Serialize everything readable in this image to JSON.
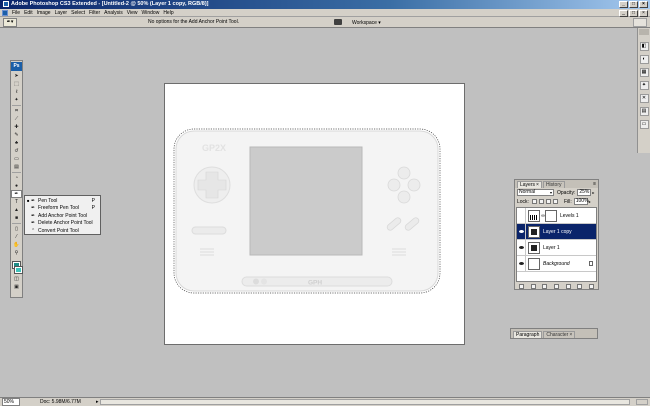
{
  "app": {
    "title": "Adobe Photoshop CS3 Extended - [Untitled-2 @ 50% (Layer 1 copy, RGB/8)]",
    "window_controls": [
      "_",
      "□",
      "×"
    ]
  },
  "menubar": {
    "items": [
      "File",
      "Edit",
      "Image",
      "Layer",
      "Select",
      "Filter",
      "Analysis",
      "View",
      "Window",
      "Help"
    ],
    "doc_controls": [
      "_",
      "□",
      "×"
    ]
  },
  "optionsbar": {
    "message": "No options for the Add Anchor Point Tool.",
    "workspace_label": "Workspace ▾"
  },
  "toolbox": {
    "logo": "Ps",
    "tools": [
      {
        "name": "move-tool",
        "glyph": "➤"
      },
      {
        "name": "marquee-tool",
        "glyph": "⬚"
      },
      {
        "name": "lasso-tool",
        "glyph": "ℓ"
      },
      {
        "name": "magic-wand-tool",
        "glyph": "✦"
      },
      {
        "name": "crop-tool",
        "glyph": "⌗"
      },
      {
        "name": "slice-tool",
        "glyph": "⟋"
      },
      {
        "name": "healing-brush-tool",
        "glyph": "✚"
      },
      {
        "name": "brush-tool",
        "glyph": "✎"
      },
      {
        "name": "clone-stamp-tool",
        "glyph": "♣"
      },
      {
        "name": "history-brush-tool",
        "glyph": "↺"
      },
      {
        "name": "eraser-tool",
        "glyph": "▭"
      },
      {
        "name": "gradient-tool",
        "glyph": "▤"
      },
      {
        "name": "blur-tool",
        "glyph": "◔"
      },
      {
        "name": "dodge-tool",
        "glyph": "●"
      },
      {
        "name": "pen-tool",
        "glyph": "✒"
      },
      {
        "name": "type-tool",
        "glyph": "T"
      },
      {
        "name": "path-selection-tool",
        "glyph": "▲"
      },
      {
        "name": "shape-tool",
        "glyph": "■"
      },
      {
        "name": "notes-tool",
        "glyph": "▯"
      },
      {
        "name": "eyedropper-tool",
        "glyph": "⁄"
      },
      {
        "name": "hand-tool",
        "glyph": "✋"
      },
      {
        "name": "zoom-tool",
        "glyph": "⚲"
      }
    ],
    "colors": {
      "foreground": "#1e8d86",
      "background": "#3fc3ba"
    },
    "bottom": [
      {
        "name": "quick-mask-icon",
        "glyph": "◫"
      },
      {
        "name": "screen-mode-icon",
        "glyph": "▣"
      }
    ]
  },
  "flyout": {
    "items": [
      {
        "label": "Pen Tool",
        "shortcut": "P",
        "selected": true
      },
      {
        "label": "Freeform Pen Tool",
        "shortcut": "P",
        "selected": false
      },
      {
        "label": "Add Anchor Point Tool",
        "shortcut": "",
        "selected": false
      },
      {
        "label": "Delete Anchor Point Tool",
        "shortcut": "",
        "selected": false
      },
      {
        "label": "Convert Point Tool",
        "shortcut": "",
        "selected": false
      }
    ]
  },
  "canvas": {
    "device_logo": "GP2X",
    "device_brand": "GPH"
  },
  "layers_panel": {
    "tabs": [
      "Layers",
      "History"
    ],
    "blend_mode": "Normal",
    "opacity_label": "Opacity:",
    "opacity_value": "25%",
    "lock_label": "Lock:",
    "fill_label": "Fill:",
    "fill_value": "100%",
    "layers": [
      {
        "name": "Levels 1",
        "selected": false,
        "visible": false,
        "thumb": "adj"
      },
      {
        "name": "Layer 1 copy",
        "selected": true,
        "visible": true,
        "thumb": "dark"
      },
      {
        "name": "Layer 1",
        "selected": false,
        "visible": true,
        "thumb": "dark"
      },
      {
        "name": "Background",
        "selected": false,
        "visible": true,
        "thumb": "white"
      }
    ]
  },
  "para_panel": {
    "tabs": [
      "Paragraph",
      "Character"
    ]
  },
  "status": {
    "zoom": "50%",
    "doc_info": "Doc: 5.98M/6.77M"
  }
}
